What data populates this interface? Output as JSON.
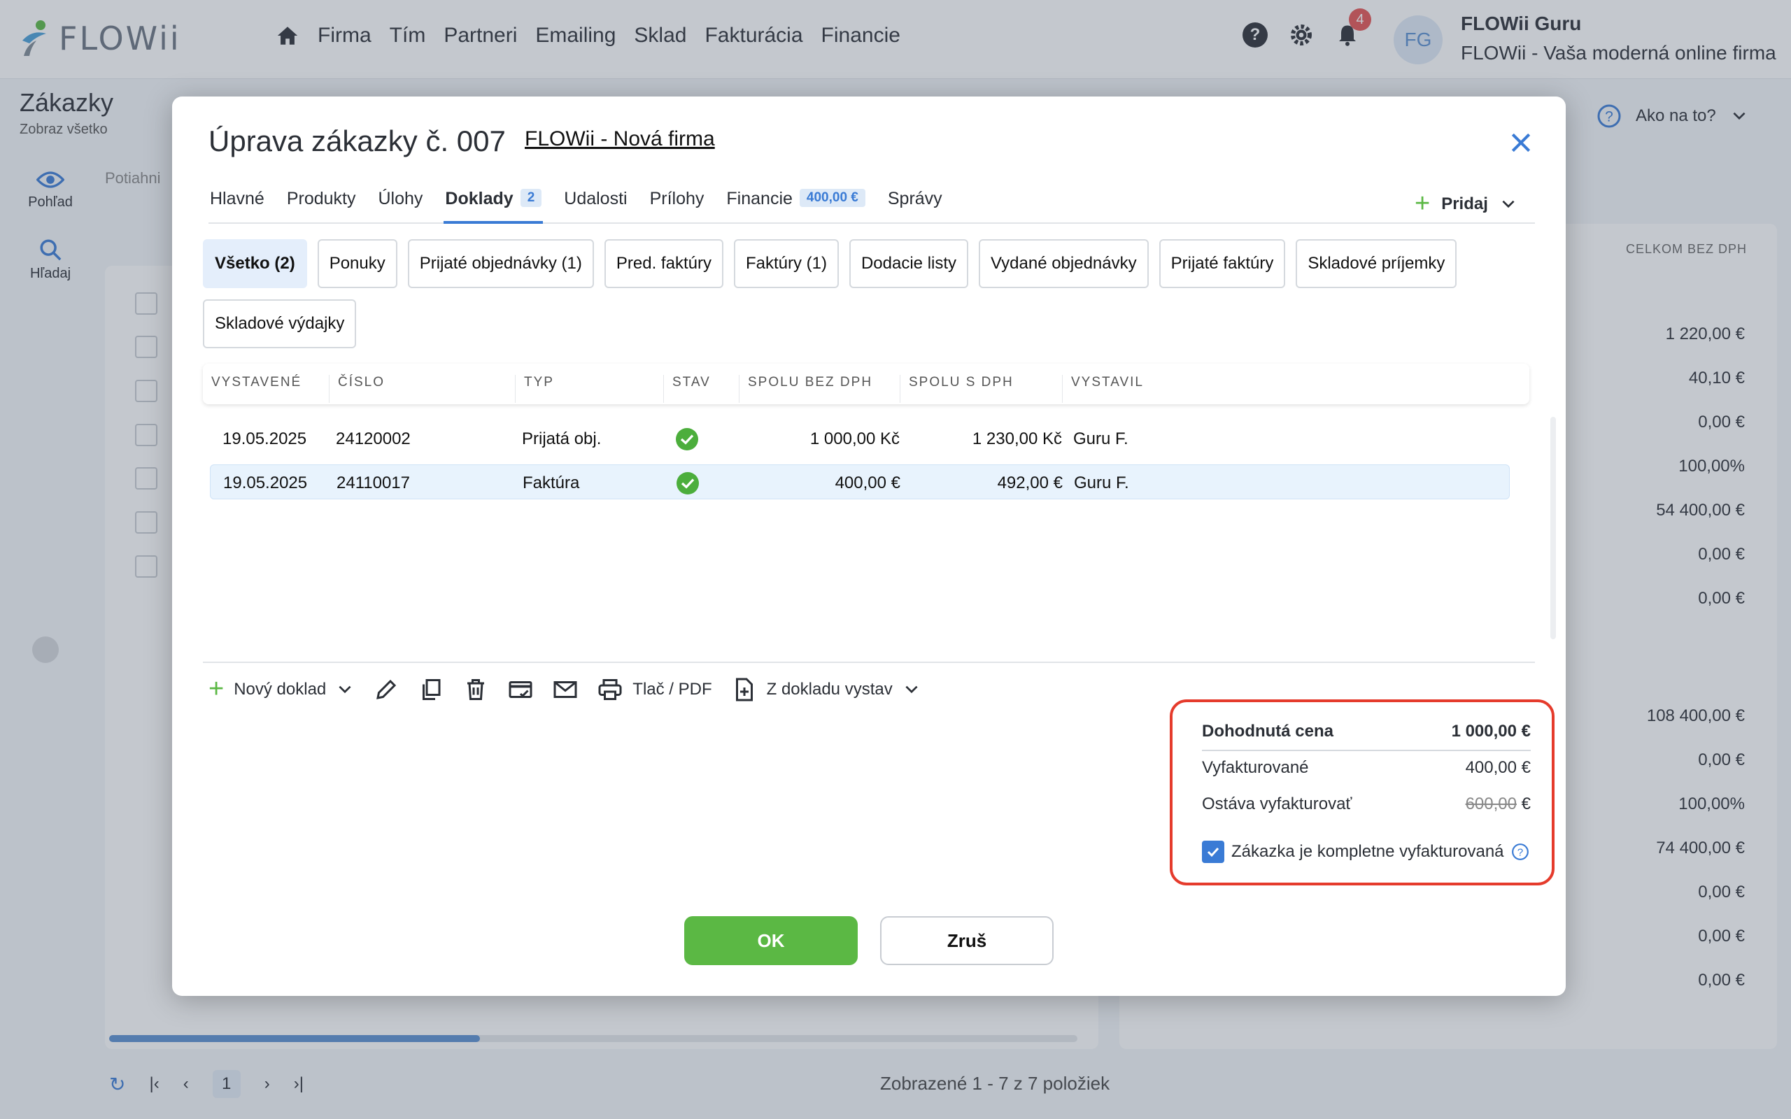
{
  "app": {
    "logo_text": "FLOWii",
    "nav": [
      "Firma",
      "Tím",
      "Partneri",
      "Emailing",
      "Sklad",
      "Fakturácia",
      "Financie"
    ],
    "notifications_count": "4",
    "avatar_initials": "FG",
    "user_name": "FLOWii Guru",
    "user_company": "FLOWii - Vaša moderná online firma"
  },
  "page": {
    "title": "Zákazky",
    "subtitle": "Zobraz všetko",
    "help_label": "Ako na to?",
    "side": {
      "view": "Pohľad",
      "search": "Hľadaj"
    },
    "drag_hint": "Potiahni",
    "right_col_header": "CELKOM BEZ DPH",
    "right_values": [
      "1 220,00 €",
      "40,10 €",
      "0,00 €",
      "100,00%",
      "54 400,00 €",
      "0,00 €",
      "0,00 €",
      "108 400,00 €",
      "0,00 €",
      "100,00%",
      "74 400,00 €",
      "0,00 €",
      "0,00 €",
      "0,00 €"
    ],
    "pager_page": "1",
    "pager_summary": "Zobrazené 1 - 7 z 7 položiek"
  },
  "modal": {
    "title": "Úprava zákazky č. 007",
    "company_link": "FLOWii - Nová firma",
    "tabs": [
      {
        "label": "Hlavné"
      },
      {
        "label": "Produkty"
      },
      {
        "label": "Úlohy"
      },
      {
        "label": "Doklady",
        "badge": "2"
      },
      {
        "label": "Udalosti"
      },
      {
        "label": "Prílohy"
      },
      {
        "label": "Financie",
        "badge": "400,00 €"
      },
      {
        "label": "Správy"
      }
    ],
    "add_label": "Pridaj",
    "filters": [
      "Všetko (2)",
      "Ponuky",
      "Prijaté objednávky (1)",
      "Pred. faktúry",
      "Faktúry (1)",
      "Dodacie listy",
      "Vydané objednávky",
      "Prijaté faktúry",
      "Skladové príjemky",
      "Skladové výdajky"
    ],
    "table": {
      "headers": [
        "VYSTAVENÉ",
        "ČÍSLO",
        "TYP",
        "STAV",
        "SPOLU BEZ DPH",
        "SPOLU S DPH",
        "VYSTAVIL"
      ],
      "rows": [
        {
          "date": "19.05.2025",
          "number": "24120002",
          "type": "Prijatá obj.",
          "net": "1 000,00 Kč",
          "gross": "1 230,00 Kč",
          "author": "Guru F."
        },
        {
          "date": "19.05.2025",
          "number": "24110017",
          "type": "Faktúra",
          "net": "400,00 €",
          "gross": "492,00 €",
          "author": "Guru F."
        }
      ]
    },
    "toolbar": {
      "new_doc": "Nový doklad",
      "print": "Tlač / PDF",
      "from_doc": "Z dokladu vystav"
    },
    "summary": {
      "agreed_label": "Dohodnutá cena",
      "agreed_value": "1 000,00 €",
      "invoiced_label": "Vyfakturované",
      "invoiced_value": "400,00 €",
      "remaining_label": "Ostáva vyfakturovať",
      "remaining_value_struck": "600,00",
      "remaining_currency": "€",
      "complete_label": "Zákazka je kompletne vyfakturovaná",
      "complete_checked": true
    },
    "ok_label": "OK",
    "cancel_label": "Zruš"
  },
  "colors": {
    "accent": "#3a7bd5",
    "ok_green": "#5bb844",
    "status_green": "#4cae3c",
    "highlight_red": "#e53b2c",
    "badge_red": "#e55353"
  }
}
